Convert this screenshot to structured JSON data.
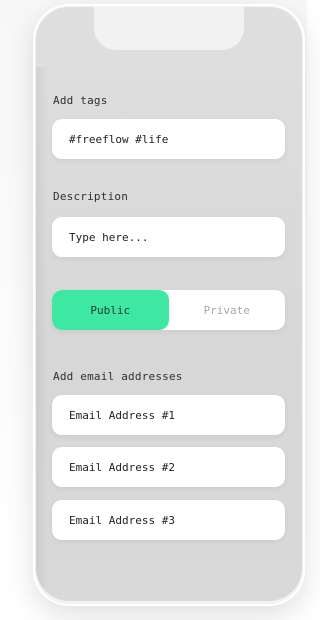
{
  "form": {
    "tags_label": "Add tags",
    "tags_value": "#freeflow #life",
    "description_label": "Description",
    "description_placeholder": "Type here...",
    "visibility": {
      "public_label": "Public",
      "private_label": "Private",
      "selected": "Public",
      "active_color": "#3ee8a3"
    },
    "emails_label": "Add email addresses",
    "emails": [
      {
        "placeholder": "Email Address #1"
      },
      {
        "placeholder": "Email Address #2"
      },
      {
        "placeholder": "Email Address #3"
      }
    ]
  }
}
